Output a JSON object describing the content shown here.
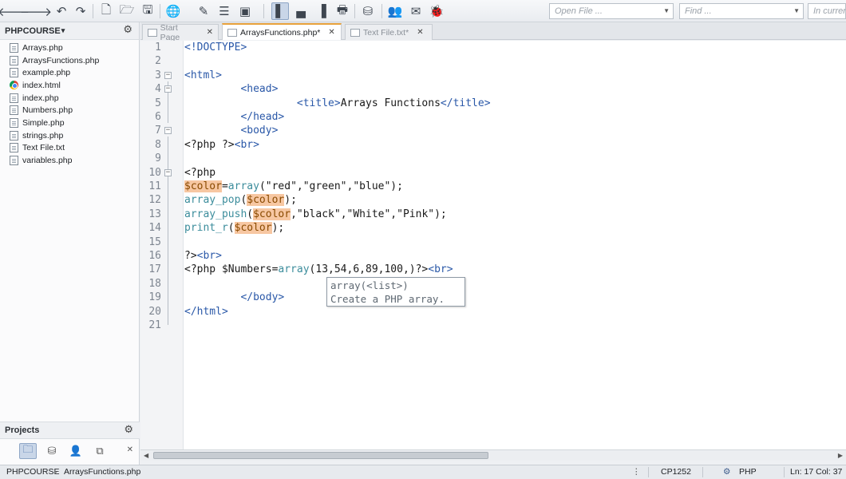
{
  "toolbar": {
    "open_file_placeholder": "Open File ...",
    "find_placeholder": "Find ...",
    "scope_placeholder": "In current"
  },
  "project_panel": {
    "title": "PHPCOURSE",
    "files": [
      {
        "name": "Arrays.php",
        "icon": "file-icon"
      },
      {
        "name": "ArraysFunctions.php",
        "icon": "file-icon"
      },
      {
        "name": "example.php",
        "icon": "file-icon"
      },
      {
        "name": "index.html",
        "icon": "chrome-icon"
      },
      {
        "name": "index.php",
        "icon": "file-icon"
      },
      {
        "name": "Numbers.php",
        "icon": "file-icon"
      },
      {
        "name": "Simple.php",
        "icon": "file-icon"
      },
      {
        "name": "strings.php",
        "icon": "file-icon"
      },
      {
        "name": "Text File.txt",
        "icon": "file-icon"
      },
      {
        "name": "variables.php",
        "icon": "file-icon"
      }
    ],
    "projects_label": "Projects"
  },
  "editor_tabs": [
    {
      "label": "Start Page",
      "active": false
    },
    {
      "label": "ArraysFunctions.php*",
      "active": true
    },
    {
      "label": "Text File.txt*",
      "active": false
    }
  ],
  "code_lines": [
    {
      "n": "1",
      "fold": "",
      "html": "<span class=\"tag\">&lt;!DOCTYPE&gt;</span>"
    },
    {
      "n": "2",
      "fold": "",
      "html": ""
    },
    {
      "n": "3",
      "fold": "−",
      "html": "<span class=\"tag\">&lt;html&gt;</span>"
    },
    {
      "n": "4",
      "fold": "−",
      "html": "         <span class=\"tag\">&lt;head&gt;</span>"
    },
    {
      "n": "5",
      "fold": "",
      "html": "                  <span class=\"tag\">&lt;title&gt;</span>Arrays Functions<span class=\"tag\">&lt;/title&gt;</span>"
    },
    {
      "n": "6",
      "fold": "",
      "html": "         <span class=\"tag\">&lt;/head&gt;</span>"
    },
    {
      "n": "7",
      "fold": "−",
      "html": "         <span class=\"tag\">&lt;body&gt;</span>"
    },
    {
      "n": "8",
      "fold": "",
      "html": "&lt;?php ?&gt;<span class=\"tag\">&lt;br&gt;</span>"
    },
    {
      "n": "9",
      "fold": "",
      "html": ""
    },
    {
      "n": "10",
      "fold": "−",
      "html": "&lt;?php"
    },
    {
      "n": "11",
      "fold": "",
      "html": "<span class=\"var\">$color</span>=<span class=\"fn\">array</span>(\"red\",\"green\",\"blue\");"
    },
    {
      "n": "12",
      "fold": "",
      "html": "<span class=\"fn\">array_pop</span>(<span class=\"var\">$color</span>);"
    },
    {
      "n": "13",
      "fold": "",
      "html": "<span class=\"fn\">array_push</span>(<span class=\"var\">$color</span>,\"black\",\"White\",\"Pink\");"
    },
    {
      "n": "14",
      "fold": "",
      "html": "<span class=\"fn\">print_r</span>(<span class=\"var\">$color</span>);"
    },
    {
      "n": "15",
      "fold": "",
      "html": ""
    },
    {
      "n": "16",
      "fold": "",
      "html": "?&gt;<span class=\"tag\">&lt;br&gt;</span>"
    },
    {
      "n": "17",
      "fold": "",
      "html": "&lt;?php $Numbers=<span class=\"fn\">array</span>(13,54,6,89,100,)?&gt;<span class=\"tag\">&lt;br&gt;</span>"
    },
    {
      "n": "18",
      "fold": "",
      "html": ""
    },
    {
      "n": "19",
      "fold": "",
      "html": "         <span class=\"tag\">&lt;/body&gt;</span>"
    },
    {
      "n": "20",
      "fold": "",
      "html": "<span class=\"tag\">&lt;/html&gt;</span>"
    },
    {
      "n": "21",
      "fold": "",
      "html": ""
    }
  ],
  "autocomplete": {
    "signature": "array(<list>)",
    "description": "Create a PHP array."
  },
  "statusbar": {
    "breadcrumb_project": "PHPCOURSE",
    "breadcrumb_file": "ArraysFunctions.php",
    "encoding": "CP1252",
    "language": "PHP",
    "position": "Ln: 17 Col: 37"
  },
  "colors": {
    "accent_tab": "#e8a13b",
    "tag": "#2a58a8",
    "function": "#3c8d9c",
    "variable_highlight": "#f7c7a2"
  }
}
